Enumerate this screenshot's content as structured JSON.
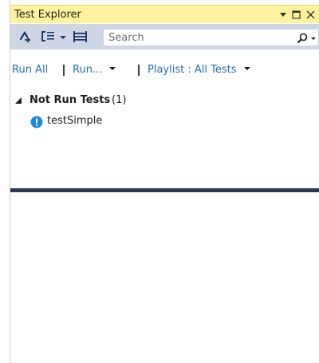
{
  "window": {
    "title": "Test Explorer",
    "controls": {
      "dropdown_icon": "dropdown-arrow-icon",
      "maximize_icon": "maximize-icon",
      "close_icon": "close-icon"
    },
    "title_bg": "#fff29d"
  },
  "toolbar": {
    "bg": "#cfd6e5",
    "buttons": [
      {
        "icon": "run-settings-icon"
      },
      {
        "icon": "group-by-icon"
      },
      {
        "icon": "group-by-dropdown-icon"
      },
      {
        "icon": "list-view-icon"
      }
    ],
    "search": {
      "placeholder": "Search",
      "icon": "search-icon",
      "dropdown_icon": "search-dropdown-icon"
    }
  },
  "commands": {
    "run_all": "Run All",
    "run": "Run...",
    "playlist": "Playlist : All Tests",
    "link_color": "#1e6fb5"
  },
  "tree": {
    "groups": [
      {
        "label": "Not Run Tests",
        "count": "(1)",
        "expanded": true,
        "items": [
          {
            "name": "testSimple",
            "status_icon": "not-run-info-icon",
            "status_color": "#1e88e5"
          }
        ]
      }
    ]
  },
  "splitter_color": "#293955"
}
